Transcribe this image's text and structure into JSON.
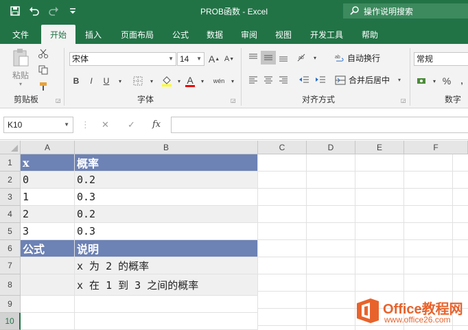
{
  "titlebar": {
    "title": "PROB函数 - Excel",
    "tell_me": "操作说明搜索",
    "accent": "#217346"
  },
  "tabs": [
    "文件",
    "开始",
    "插入",
    "页面布局",
    "公式",
    "数据",
    "审阅",
    "视图",
    "开发工具",
    "帮助"
  ],
  "ribbon": {
    "clipboard": {
      "paste": "粘贴",
      "label": "剪贴板"
    },
    "font": {
      "name": "宋体",
      "size": "14",
      "label": "字体",
      "bold": "B",
      "italic": "I",
      "underline": "U",
      "fontsize_up": "A",
      "fontsize_down": "A",
      "font_color": "A",
      "phonetic": "wén"
    },
    "alignment": {
      "wrap": "自动换行",
      "merge": "合并后居中",
      "label": "对齐方式"
    },
    "number": {
      "format": "常规",
      "label": "数字",
      "percent": "%"
    }
  },
  "formula_bar": {
    "name_box": "K10",
    "fx": "fx",
    "value": ""
  },
  "grid": {
    "columns": [
      "A",
      "B",
      "C",
      "D",
      "E",
      "F"
    ],
    "rows": [
      "1",
      "2",
      "3",
      "4",
      "5",
      "6",
      "7",
      "8",
      "9",
      "10"
    ],
    "cells": {
      "A1": "x",
      "B1": "概率",
      "A2": "0",
      "B2": "0.2",
      "A3": "1",
      "B3": "0.3",
      "A4": "2",
      "B4": "0.2",
      "A5": "3",
      "B5": "0.3",
      "A6": "公式",
      "B6": "说明",
      "B7": "x 为 2 的概率",
      "B8": "x 在 1 到 3 之间的概率"
    },
    "header_fill": "#6d82b5",
    "band_fill": "#f0f0f0"
  },
  "watermark": {
    "title": "Office教程网",
    "url": "www.office26.com"
  }
}
